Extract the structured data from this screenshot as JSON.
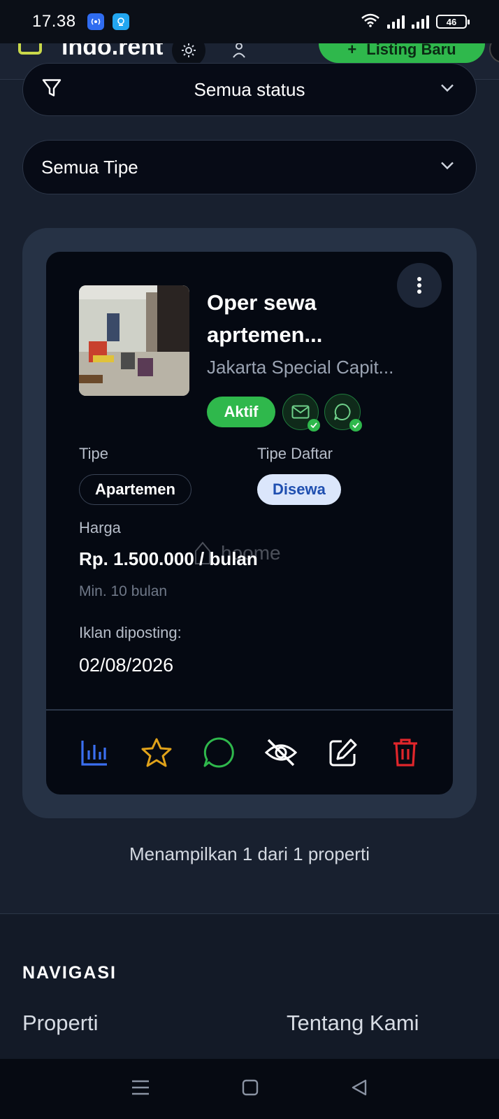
{
  "status_bar": {
    "time": "17.38",
    "battery": "46"
  },
  "app_header": {
    "logo_text": "indo.rent",
    "new_listing_label": "Listing Baru"
  },
  "filters": {
    "status": "Semua status",
    "type": "Semua Tipe"
  },
  "listing": {
    "title_line1": "Oper sewa",
    "title_line2": "aprtemen...",
    "location": "Jakarta Special Capit...",
    "status_badge": "Aktif",
    "type_label": "Tipe",
    "type_value": "Apartemen",
    "listing_type_label": "Tipe Daftar",
    "listing_type_value": "Disewa",
    "price_label": "Harga",
    "price": "Rp. 1.500.000 / bulan",
    "min_duration": "Min. 10 bulan",
    "posted_label": "Iklan diposting:",
    "posted_date": "02/08/2026",
    "watermark": "hoome"
  },
  "summary": "Menampilkan 1 dari 1 properti",
  "footer": {
    "nav_title": "NAVIGASI",
    "link_properti": "Properti",
    "link_about": "Tentang Kami"
  },
  "colors": {
    "accent_green": "#2fb84c",
    "stats_blue": "#3b6ff0",
    "star_amber": "#e0a21a",
    "delete_red": "#e0262b"
  },
  "icons": [
    "filter-icon",
    "chevron-down-icon",
    "more-vertical-icon",
    "mail-verified-icon",
    "chat-verified-icon",
    "stats-icon",
    "star-icon",
    "chat-icon",
    "eye-off-icon",
    "edit-icon",
    "trash-icon"
  ]
}
